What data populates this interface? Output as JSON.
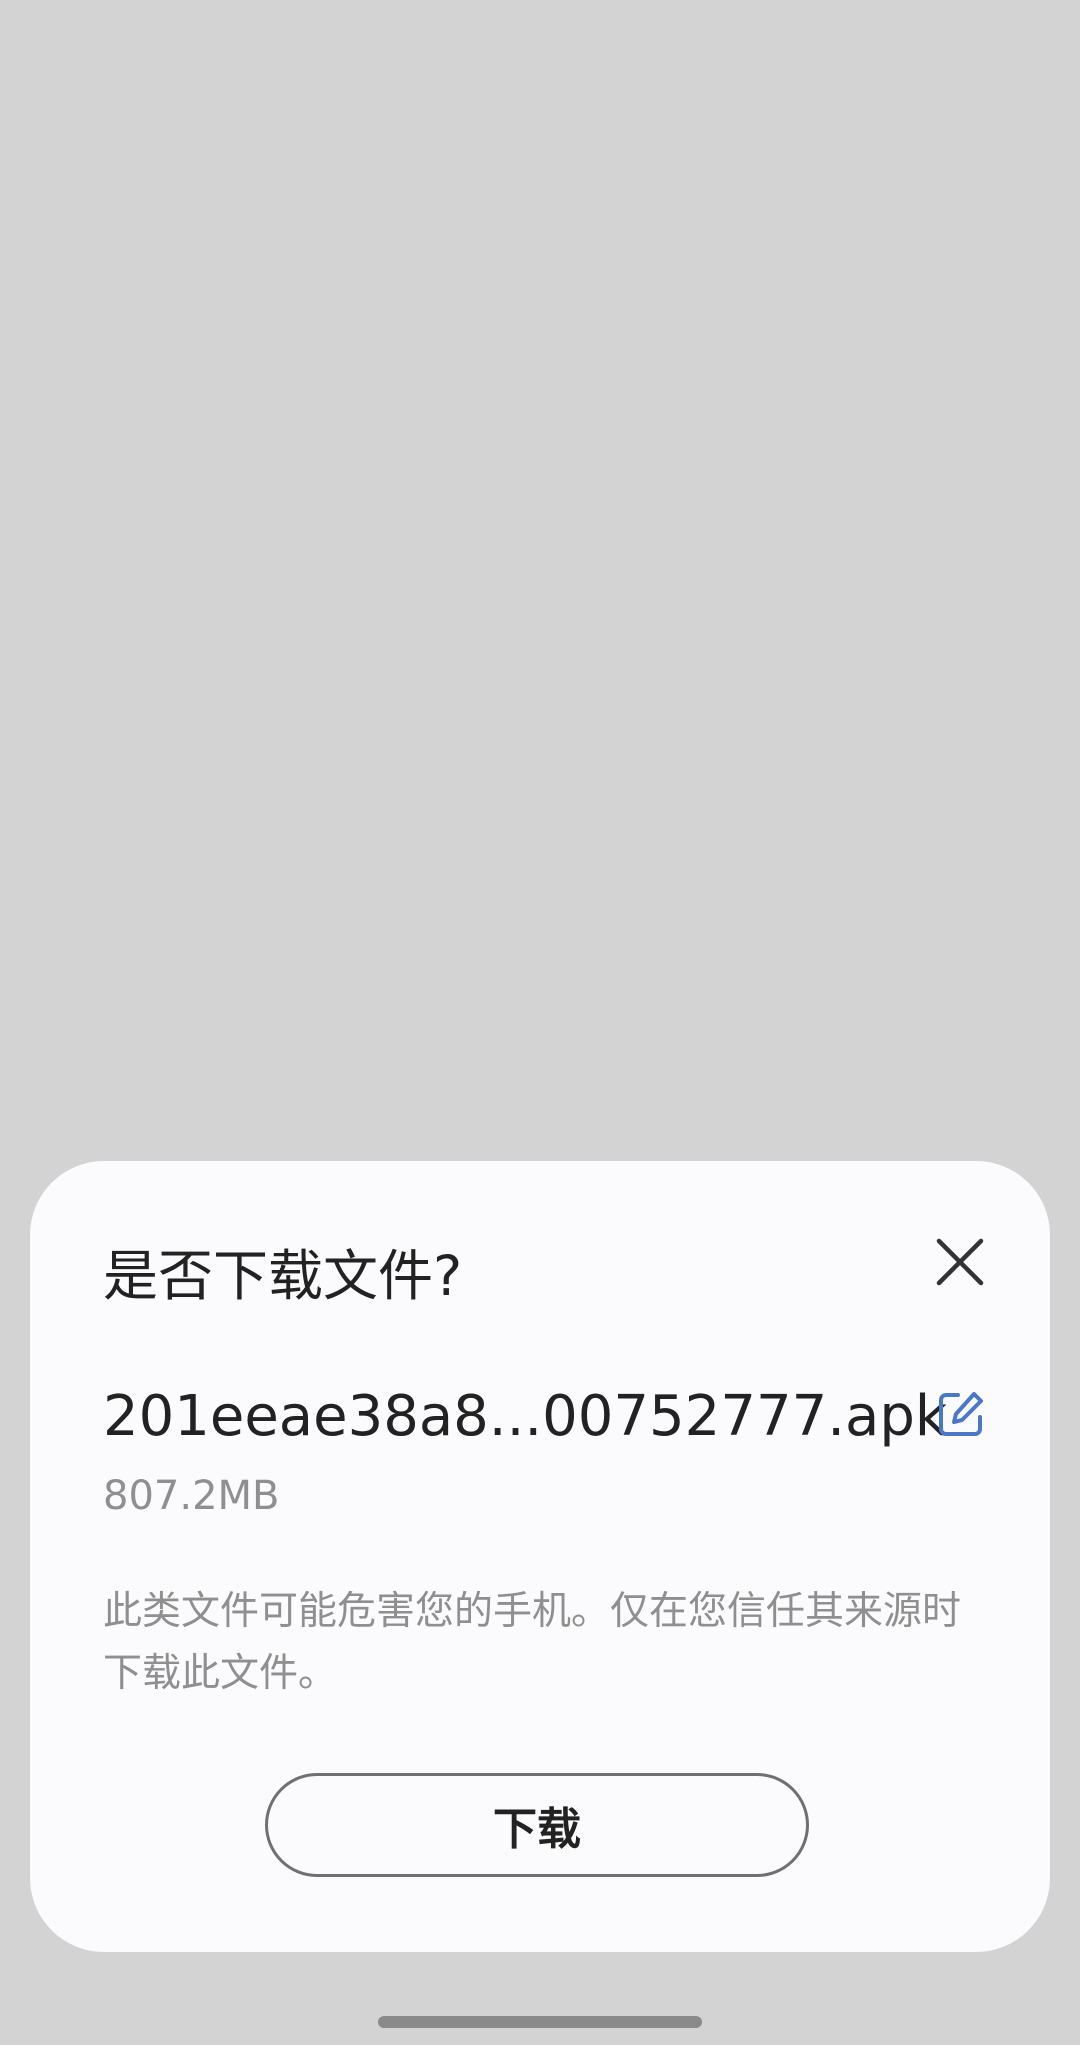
{
  "dialog": {
    "title": "是否下载文件?",
    "filename": "201eeae38a8...00752777.apk",
    "filesize": "807.2MB",
    "warning": "此类文件可能危害您的手机。仅在您信任其来源时下载此文件。",
    "download_label": "下载",
    "close_icon": "close-icon",
    "edit_icon": "edit-icon",
    "accent_color": "#4a78c8"
  }
}
